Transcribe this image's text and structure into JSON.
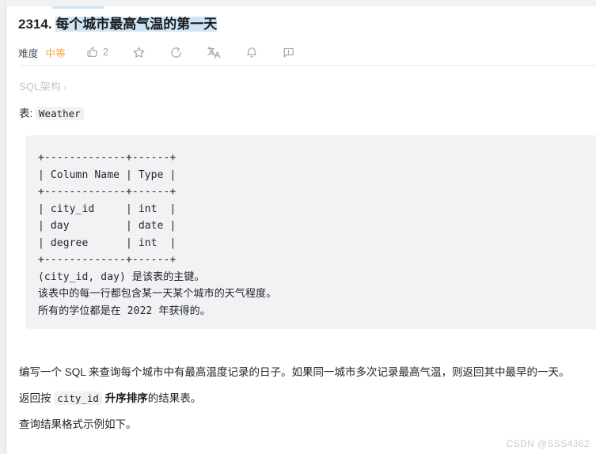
{
  "page": {
    "background": "#ffffff",
    "accent_orange": "#f8a33c",
    "selection_highlight": "#cfe5f5",
    "code_bg": "#f1f2f4"
  },
  "header": {
    "problem_number": "2314.",
    "problem_title": "每个城市最高气温的第一天"
  },
  "meta": {
    "difficulty_label": "难度",
    "difficulty_value": "中等",
    "like_count": "2",
    "icons": [
      {
        "name": "thumbs-up-icon",
        "label": "2"
      },
      {
        "name": "star-icon",
        "label": ""
      },
      {
        "name": "share-icon",
        "label": ""
      },
      {
        "name": "translate-icon",
        "label": ""
      },
      {
        "name": "bell-icon",
        "label": ""
      },
      {
        "name": "comment-icon",
        "label": ""
      }
    ]
  },
  "schema": {
    "breadcrumb_label": "SQL架构",
    "breadcrumb_chevron": "›"
  },
  "table_section": {
    "caption_prefix": "表:",
    "table_name": "Weather",
    "schema_block": "+-------------+------+\n| Column Name | Type |\n+-------------+------+\n| city_id     | int  |\n| day         | date |\n| degree      | int  |\n+-------------+------+\n(city_id, day) 是该表的主键。\n该表中的每一行都包含某一天某个城市的天气程度。\n所有的学位都是在 2022 年获得的。",
    "columns": [
      {
        "name": "city_id",
        "type": "int"
      },
      {
        "name": "day",
        "type": "date"
      },
      {
        "name": "degree",
        "type": "int"
      }
    ],
    "column_headers": [
      "Column Name",
      "Type"
    ],
    "notes": [
      "(city_id, day) 是该表的主键。",
      "该表中的每一行都包含某一天某个城市的天气程度。",
      "所有的学位都是在 2022 年获得的。"
    ]
  },
  "description": {
    "paragraph_1": "编写一个 SQL 来查询每个城市中有最高温度记录的日子。如果同一城市多次记录最高气温，则返回其中最早的一天。",
    "paragraph_2_prefix": "返回按",
    "paragraph_2_code": "city_id",
    "paragraph_2_bold": "升序排序",
    "paragraph_2_suffix": "的结果表。",
    "paragraph_3": "查询结果格式示例如下。"
  },
  "watermark": {
    "text": "CSDN @SSS4362"
  }
}
